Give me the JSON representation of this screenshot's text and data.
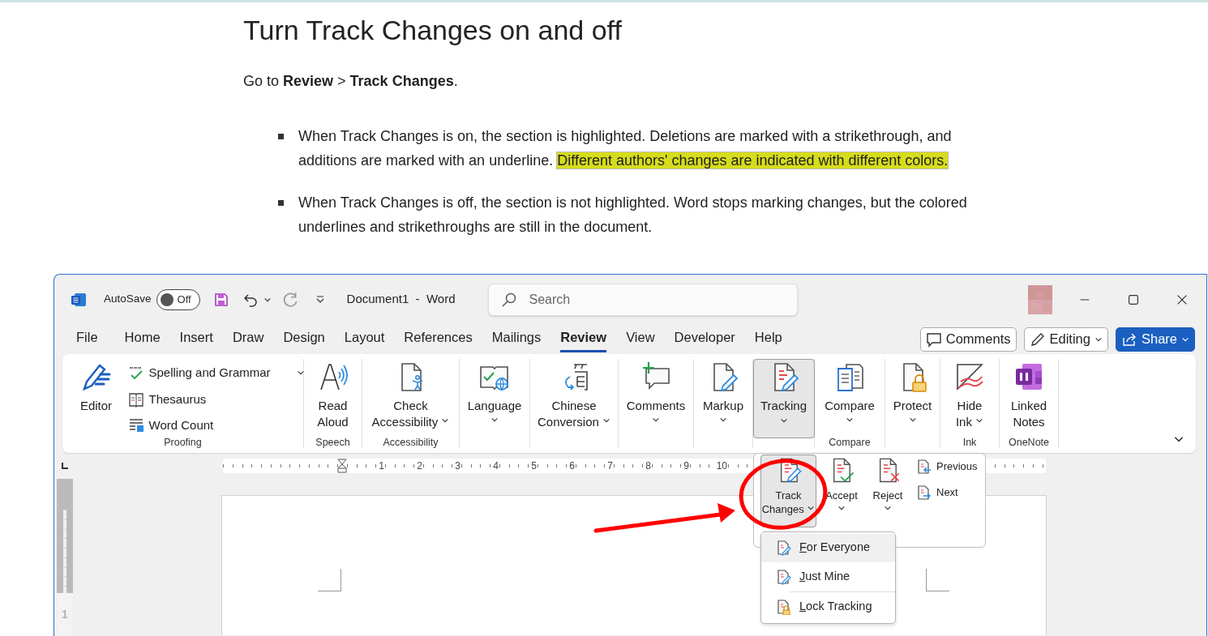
{
  "article": {
    "heading": "Turn Track Changes on and off",
    "intro": "Go to **Review** > **Track Changes**.",
    "bullets": [
      {
        "text": "When Track Changes is on, the section is highlighted. Deletions are marked with a strikethrough, and additions are marked with an underline.",
        "highlighted": "Different authors' changes are indicated with different colors."
      },
      {
        "text": "When Track Changes is off, the section is not highlighted. Word stops marking changes, but the colored underlines and strikethroughs are still in the document."
      }
    ]
  },
  "window": {
    "title_bar": {
      "autosave": {
        "label": "AutoSave",
        "on": false,
        "state": "Off"
      },
      "document_title": "Document1  -  Word",
      "search": {
        "placeholder": "Search"
      }
    },
    "tabs": [
      {
        "label": "File",
        "selected": false
      },
      {
        "label": "Home",
        "selected": false
      },
      {
        "label": "Insert",
        "selected": false
      },
      {
        "label": "Draw",
        "selected": false
      },
      {
        "label": "Design",
        "selected": false
      },
      {
        "label": "Layout",
        "selected": false
      },
      {
        "label": "References",
        "selected": false
      },
      {
        "label": "Mailings",
        "selected": false
      },
      {
        "label": "Review",
        "selected": true
      },
      {
        "label": "View",
        "selected": false
      },
      {
        "label": "Developer",
        "selected": false
      },
      {
        "label": "Help",
        "selected": false
      }
    ],
    "header_buttons": [
      {
        "label": "Comments",
        "kind": "outline"
      },
      {
        "label": "Editing",
        "kind": "outline",
        "dropdown": true
      },
      {
        "label": "Share",
        "kind": "primary",
        "dropdown": true
      }
    ],
    "ribbon": {
      "groups": [
        {
          "label": "Proofing",
          "commands": [
            {
              "label": "Editor",
              "kind": "large"
            },
            {
              "label": "Spelling and Grammar",
              "kind": "small",
              "dropdown": true
            },
            {
              "label": "Thesaurus",
              "kind": "small"
            },
            {
              "label": "Word Count",
              "kind": "small"
            }
          ]
        },
        {
          "label": "Speech",
          "commands": [
            {
              "label": "Read Aloud",
              "kind": "large"
            }
          ]
        },
        {
          "label": "Accessibility",
          "commands": [
            {
              "label": "Check Accessibility",
              "kind": "large",
              "dropdown": true
            }
          ]
        },
        {
          "commands": [
            {
              "label": "Language",
              "kind": "large",
              "dropdown": true
            }
          ]
        },
        {
          "commands": [
            {
              "label": "Chinese Conversion",
              "kind": "large",
              "dropdown": true
            }
          ]
        },
        {
          "commands": [
            {
              "label": "Comments",
              "kind": "large",
              "dropdown": true
            }
          ]
        },
        {
          "commands": [
            {
              "label": "Markup",
              "kind": "large",
              "dropdown": true
            }
          ]
        },
        {
          "commands": [
            {
              "label": "Tracking",
              "kind": "large",
              "dropdown": true,
              "expanded": true
            }
          ]
        },
        {
          "label": "Compare",
          "commands": [
            {
              "label": "Compare",
              "kind": "large",
              "dropdown": true
            }
          ]
        },
        {
          "commands": [
            {
              "label": "Protect",
              "kind": "large",
              "dropdown": true
            }
          ]
        },
        {
          "label": "Ink",
          "commands": [
            {
              "label": "Hide Ink",
              "kind": "large",
              "dropdown": true
            }
          ]
        },
        {
          "label": "OneNote",
          "commands": [
            {
              "label": "Linked Notes",
              "kind": "large"
            }
          ]
        }
      ]
    },
    "ruler": {
      "numbers": [
        "1",
        "2",
        "3",
        "4",
        "5",
        "6",
        "7",
        "8",
        "9",
        "10"
      ]
    },
    "vertical_ruler": {
      "numbers": [
        "1"
      ]
    },
    "tracking_menu": {
      "commands": [
        {
          "label": "Track Changes",
          "kind": "large",
          "dropdown": true,
          "expanded": true
        },
        {
          "label": "Accept",
          "kind": "large",
          "dropdown": true
        },
        {
          "label": "Reject",
          "kind": "large",
          "dropdown": true
        },
        {
          "label": "Previous",
          "kind": "small"
        },
        {
          "label": "Next",
          "kind": "small"
        }
      ],
      "submenu": {
        "items": [
          {
            "label": "For Everyone",
            "mnemonic": true,
            "selected": true
          },
          {
            "label": "Just Mine",
            "mnemonic": true,
            "selected": false
          },
          {
            "label": "Lock Tracking",
            "mnemonic": true,
            "selected": false
          }
        ]
      }
    }
  }
}
